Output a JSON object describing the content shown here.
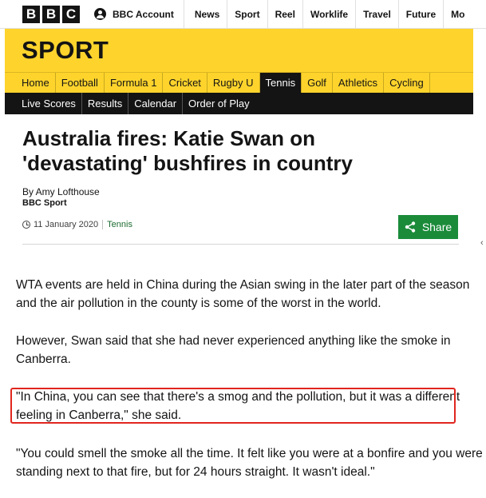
{
  "topbar": {
    "logo_letters": [
      "B",
      "B",
      "C"
    ],
    "account_label": "BBC Account",
    "nav": [
      "News",
      "Sport",
      "Reel",
      "Worklife",
      "Travel",
      "Future",
      "Mo"
    ]
  },
  "sport": {
    "title": "SPORT",
    "nav": [
      "Home",
      "Football",
      "Formula 1",
      "Cricket",
      "Rugby U",
      "Tennis",
      "Golf",
      "Athletics",
      "Cycling"
    ],
    "active_nav": "Tennis",
    "sub_nav": [
      "Live Scores",
      "Results",
      "Calendar",
      "Order of Play"
    ]
  },
  "article": {
    "headline": "Australia fires: Katie Swan on 'devastating' bushfires in country",
    "author": "By Amy Lofthouse",
    "source": "BBC Sport",
    "date": "11 January 2020",
    "tag": "Tennis",
    "share_label": "Share",
    "paragraphs": [
      "WTA events are held in China during the Asian swing in the later part of the season and the air pollution in the county is some of the worst in the world.",
      "However, Swan said that she had never experienced anything like the smoke in Canberra.",
      "\"In China, you can see that there's a smog and the pollution, but it was a different feeling in Canberra,\" she said.",
      "\"You could smell the smoke all the time. It felt like you were at a bonfire and you were standing next to that fire, but for 24 hours straight. It wasn't ideal.\""
    ]
  },
  "edge_arrow": "‹",
  "colors": {
    "sport_yellow": "#fed42c",
    "dark": "#141414",
    "share_green": "#1b8b3a",
    "tag_green": "#1c6b31",
    "highlight_red": "#e0261f"
  }
}
